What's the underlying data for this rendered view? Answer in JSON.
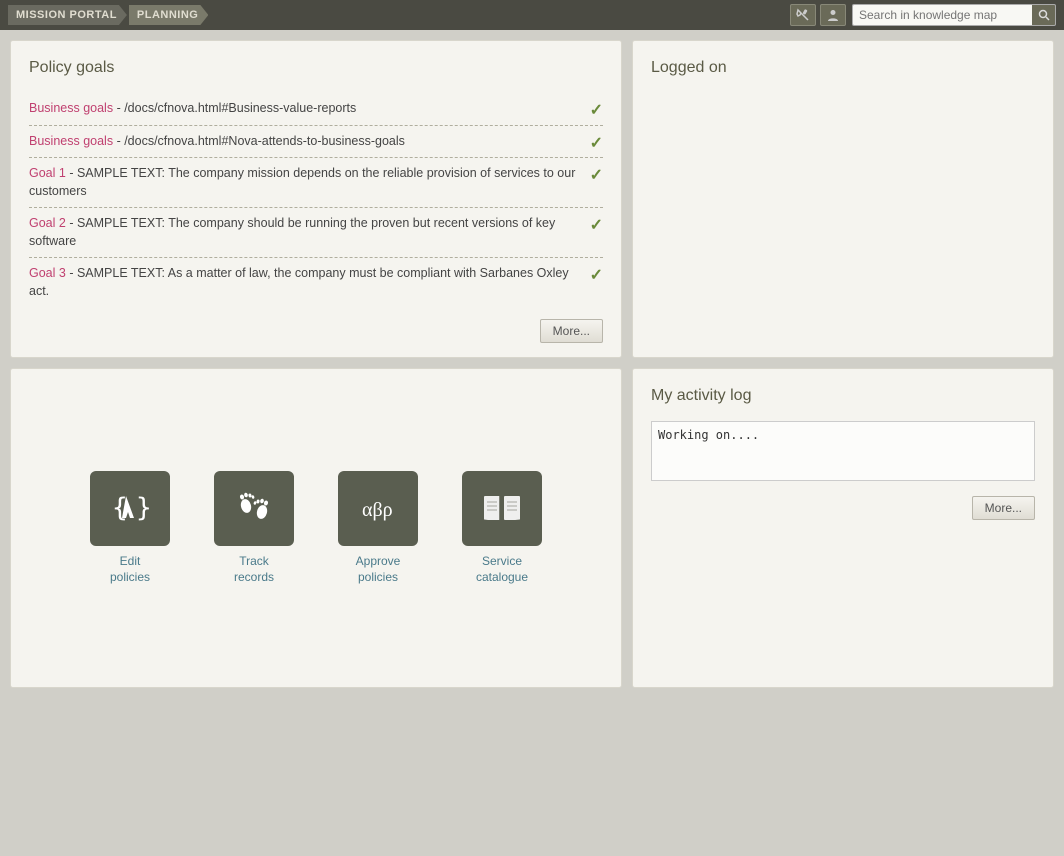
{
  "topbar": {
    "nav_items": [
      {
        "label": "MISSION PORTAL",
        "active": false
      },
      {
        "label": "PLANNING",
        "active": true
      }
    ],
    "search_placeholder": "Search in knowledge map",
    "search_value": ""
  },
  "policy_goals": {
    "title": "Policy goals",
    "items": [
      {
        "link_text": "Business goals",
        "rest_text": " - /docs/cfnova.html#Business-value-reports",
        "has_check": true
      },
      {
        "link_text": "Business goals",
        "rest_text": " - /docs/cfnova.html#Nova-attends-to-business-goals",
        "has_check": true
      },
      {
        "link_text": "Goal 1",
        "rest_text": " - SAMPLE TEXT: The company mission depends on the reliable provision of services to our customers",
        "has_check": true
      },
      {
        "link_text": "Goal 2",
        "rest_text": " - SAMPLE TEXT: The company should be running the proven but recent versions of key software",
        "has_check": true
      },
      {
        "link_text": "Goal 3",
        "rest_text": " - SAMPLE TEXT: As a matter of law, the company must be compliant with Sarbanes Oxley act.",
        "has_check": true
      }
    ],
    "more_button": "More..."
  },
  "logged_on": {
    "title": "Logged on"
  },
  "actions": {
    "items": [
      {
        "id": "edit-policies",
        "label": "Edit\npolicies",
        "icon_type": "edit"
      },
      {
        "id": "track-records",
        "label": "Track\nrecords",
        "icon_type": "track"
      },
      {
        "id": "approve-policies",
        "label": "Approve\npolicies",
        "icon_type": "approve"
      },
      {
        "id": "service-catalogue",
        "label": "Service\ncatalogue",
        "icon_type": "catalogue"
      }
    ]
  },
  "activity_log": {
    "title": "My activity log",
    "content": "Working on....",
    "more_button": "More..."
  }
}
